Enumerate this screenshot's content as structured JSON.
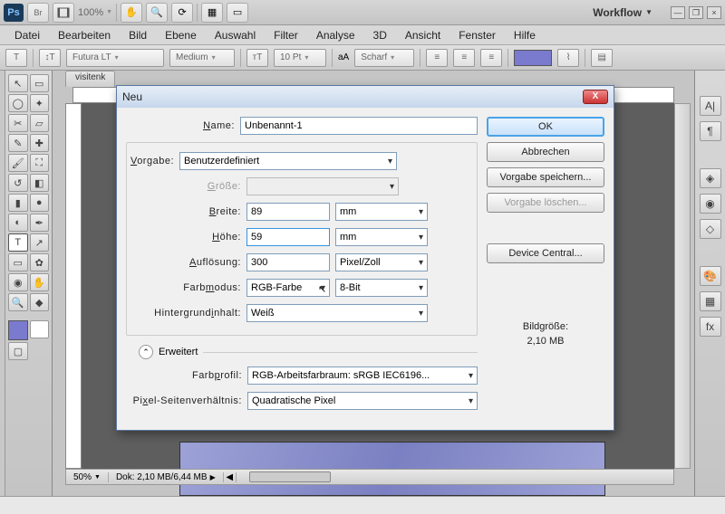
{
  "app": {
    "logo": "Ps",
    "zoom": "100%",
    "workflow_label": "Workflow"
  },
  "menus": [
    "Datei",
    "Bearbeiten",
    "Bild",
    "Ebene",
    "Auswahl",
    "Filter",
    "Analyse",
    "3D",
    "Ansicht",
    "Fenster",
    "Hilfe"
  ],
  "optbar": {
    "font": "Futura LT",
    "weight": "Medium",
    "size": "10 Pt",
    "aa_label": "aA",
    "aa_value": "Scharf"
  },
  "doc": {
    "tab": "visitenk",
    "zoom": "50%",
    "status": "Dok: 2,10 MB/6,44 MB"
  },
  "dialog": {
    "title": "Neu",
    "name_label": "Name:",
    "name_value": "Unbenannt-1",
    "preset_label": "Vorgabe:",
    "preset_value": "Benutzerdefiniert",
    "size_label": "Größe:",
    "size_value": "",
    "width_label": "Breite:",
    "width_value": "89",
    "width_unit": "mm",
    "height_label": "Höhe:",
    "height_value": "59",
    "height_unit": "mm",
    "res_label": "Auflösung:",
    "res_value": "300",
    "res_unit": "Pixel/Zoll",
    "mode_label": "Farbmodus:",
    "mode_value": "RGB-Farbe",
    "depth_value": "8-Bit",
    "bg_label": "Hintergrundinhalt:",
    "bg_value": "Weiß",
    "advanced_label": "Erweitert",
    "profile_label": "Farbprofil:",
    "profile_value": "RGB-Arbeitsfarbraum: sRGB IEC6196...",
    "par_label": "Pixel-Seitenverhältnis:",
    "par_value": "Quadratische Pixel",
    "ok": "OK",
    "cancel": "Abbrechen",
    "save_preset": "Vorgabe speichern...",
    "delete_preset": "Vorgabe löschen...",
    "device_central": "Device Central...",
    "filesize_label": "Bildgröße:",
    "filesize_value": "2,10 MB"
  },
  "panels": {
    "p1": "A|",
    "p2": "¶"
  }
}
